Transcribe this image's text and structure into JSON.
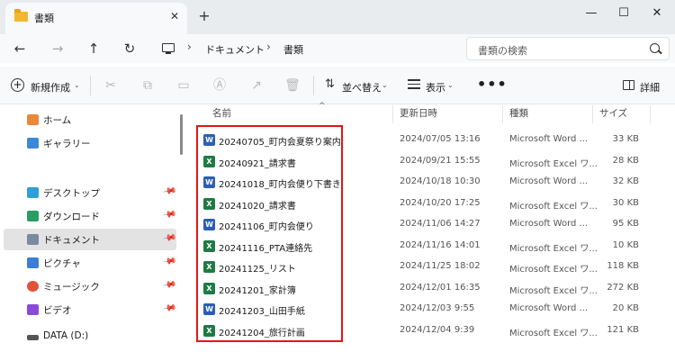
{
  "tab": {
    "title": "書類",
    "close": "✕",
    "new": "+"
  },
  "window": {
    "minimize": "—",
    "maximize": "☐",
    "close": "✕"
  },
  "nav": {
    "back": "←",
    "forward": "→",
    "up": "↑",
    "refresh": "↻"
  },
  "address": {
    "sep1": "›",
    "crumb1": "ドキュメント",
    "sep2": "›",
    "crumb2": "書類"
  },
  "search": {
    "placeholder": "書類の検索"
  },
  "toolbar": {
    "new_label": "新規作成",
    "new_caret": "⌄",
    "sort_label": "並べ替え",
    "sort_caret": "⌄",
    "view_label": "表示",
    "view_caret": "⌄",
    "more": "•••",
    "details_label": "詳細",
    "disabled_icons": [
      "cut-icon",
      "copy-icon",
      "paste-icon",
      "rename-icon",
      "share-icon",
      "delete-icon"
    ]
  },
  "sidebar": {
    "items": [
      {
        "label": "ホーム",
        "icon": "home-icon",
        "color": "#e8893a",
        "pinned": false
      },
      {
        "label": "ギャラリー",
        "icon": "gallery-icon",
        "color": "#3a88d8",
        "pinned": false
      },
      {
        "label": "デスクトップ",
        "icon": "desktop-icon",
        "color": "#2f9fd8",
        "pinned": true
      },
      {
        "label": "ダウンロード",
        "icon": "download-icon",
        "color": "#2a9d62",
        "pinned": true
      },
      {
        "label": "ドキュメント",
        "icon": "documents-icon",
        "color": "#7a8aa0",
        "pinned": true
      },
      {
        "label": "ピクチャ",
        "icon": "pictures-icon",
        "color": "#3a7ed8",
        "pinned": true
      },
      {
        "label": "ミュージック",
        "icon": "music-icon",
        "color": "#e0533a",
        "pinned": true
      },
      {
        "label": "ビデオ",
        "icon": "videos-icon",
        "color": "#8a4ad8",
        "pinned": true
      },
      {
        "label": "DATA (D:)",
        "icon": "drive-icon",
        "color": "#555555",
        "pinned": false
      }
    ],
    "selected_index": 4
  },
  "columns": {
    "name": "名前",
    "date": "更新日時",
    "type": "種類",
    "size": "サイズ"
  },
  "files": [
    {
      "name": "20240705_町内会夏祭り案内",
      "date": "2024/07/05 13:16",
      "type": "Microsoft Word ...",
      "size": "33 KB",
      "kind": "word"
    },
    {
      "name": "20240921_請求書",
      "date": "2024/09/21 15:55",
      "type": "Microsoft Excel ワ...",
      "size": "28 KB",
      "kind": "excel"
    },
    {
      "name": "20241018_町内会便り下書き",
      "date": "2024/10/18 10:30",
      "type": "Microsoft Word ...",
      "size": "32 KB",
      "kind": "word"
    },
    {
      "name": "20241020_請求書",
      "date": "2024/10/20 17:25",
      "type": "Microsoft Excel ワ...",
      "size": "30 KB",
      "kind": "excel"
    },
    {
      "name": "20241106_町内会便り",
      "date": "2024/11/06 14:27",
      "type": "Microsoft Word ...",
      "size": "95 KB",
      "kind": "word"
    },
    {
      "name": "20241116_PTA連絡先",
      "date": "2024/11/16 14:01",
      "type": "Microsoft Excel ワ...",
      "size": "10 KB",
      "kind": "excel"
    },
    {
      "name": "20241125_リスト",
      "date": "2024/11/25 18:02",
      "type": "Microsoft Excel ワ...",
      "size": "118 KB",
      "kind": "excel"
    },
    {
      "name": "20241201_家計簿",
      "date": "2024/12/01 16:35",
      "type": "Microsoft Excel ワ...",
      "size": "272 KB",
      "kind": "excel"
    },
    {
      "name": "20241203_山田手紙",
      "date": "2024/12/03 9:55",
      "type": "Microsoft Word ...",
      "size": "20 KB",
      "kind": "word"
    },
    {
      "name": "20241204_旅行計画",
      "date": "2024/12/04 9:39",
      "type": "Microsoft Excel ワ...",
      "size": "121 KB",
      "kind": "excel"
    }
  ],
  "file_icon_letters": {
    "word": "W",
    "excel": "X"
  },
  "colors": {
    "highlight": "#e0161a",
    "word": "#2b5fb4",
    "excel": "#1f7a44",
    "folder": "#f2b72c"
  }
}
